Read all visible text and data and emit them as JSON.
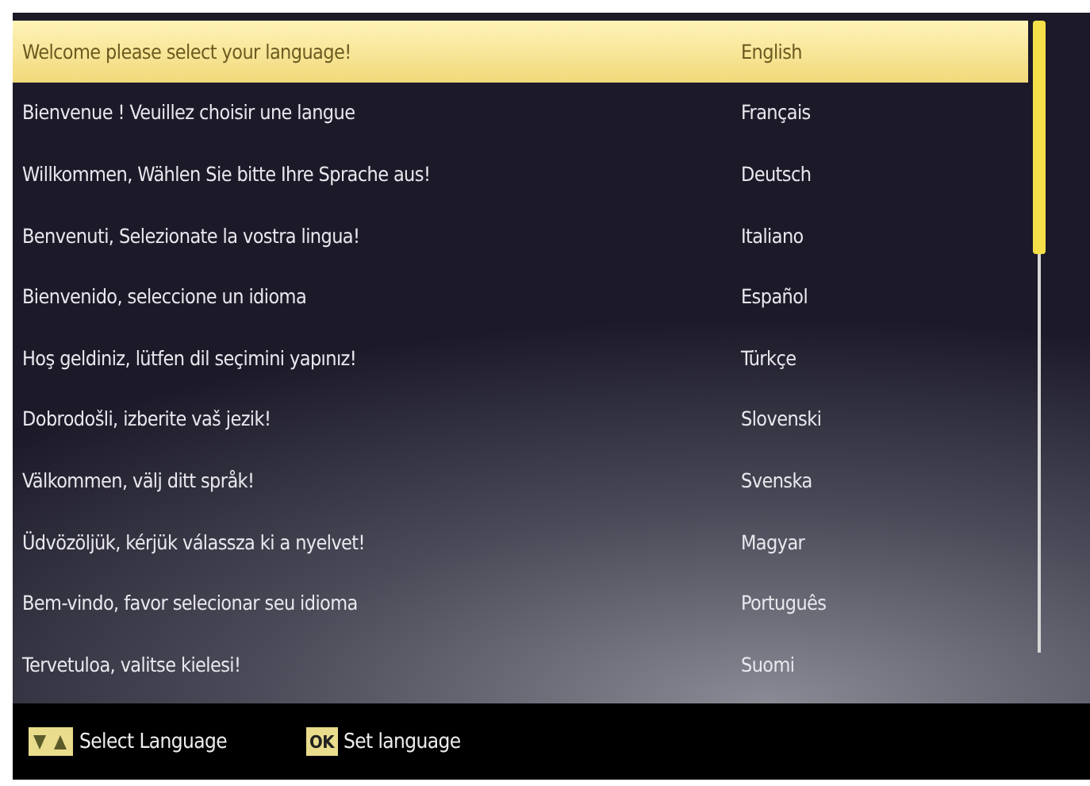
{
  "languages": [
    {
      "greeting": "Welcome please select your language!",
      "language": "English",
      "selected": true
    },
    {
      "greeting": "Bienvenue ! Veuillez choisir une langue",
      "language": "Français",
      "selected": false
    },
    {
      "greeting": "Willkommen, Wählen Sie bitte Ihre Sprache aus!",
      "language": "Deutsch",
      "selected": false
    },
    {
      "greeting": "Benvenuti, Selezionate la vostra lingua!",
      "language": "Italiano",
      "selected": false
    },
    {
      "greeting": "Bienvenido, seleccione un idioma",
      "language": "Español",
      "selected": false
    },
    {
      "greeting": "Hoş geldiniz, lütfen dil seçimini yapınız!",
      "language": "Türkçe",
      "selected": false
    },
    {
      "greeting": "Dobrodošli, izberite vaš jezik!",
      "language": "Slovenski",
      "selected": false
    },
    {
      "greeting": "Välkommen, välj ditt språk!",
      "language": "Svenska",
      "selected": false
    },
    {
      "greeting": "Üdvözöljük, kérjük válassza ki a nyelvet!",
      "language": "Magyar",
      "selected": false
    },
    {
      "greeting": "Bem-vindo, favor selecionar seu idioma",
      "language": "Português",
      "selected": false
    },
    {
      "greeting": "Tervetuloa, valitse kielesi!",
      "language": "Suomi",
      "selected": false
    }
  ],
  "footer": [
    {
      "kind": "arrows",
      "label": "Select Language"
    },
    {
      "kind": "key",
      "key": "OK",
      "label": "Set language"
    }
  ]
}
